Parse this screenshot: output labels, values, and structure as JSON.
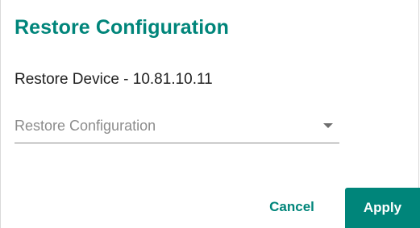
{
  "dialog": {
    "title": "Restore Configuration",
    "subtitle": "Restore Device - 10.81.10.11",
    "select": {
      "placeholder": "Restore Configuration",
      "icon": "dropdown-arrow-icon"
    },
    "buttons": {
      "cancel_label": "Cancel",
      "apply_label": "Apply"
    }
  },
  "colors": {
    "accent": "#00857a",
    "text": "#212121",
    "placeholder": "#8c8c8c"
  }
}
